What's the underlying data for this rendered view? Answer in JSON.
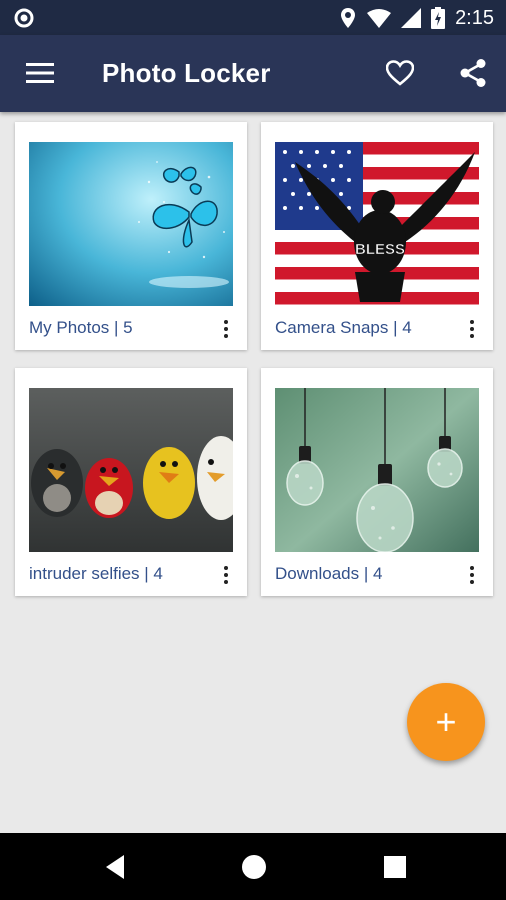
{
  "status_bar": {
    "time": "2:15"
  },
  "app_bar": {
    "title": "Photo Locker"
  },
  "albums": [
    {
      "label": "My Photos | 5"
    },
    {
      "label": "Camera Snaps | 4"
    },
    {
      "label": "intruder selfies | 4"
    },
    {
      "label": "Downloads | 4"
    }
  ],
  "fab": {
    "label": "+"
  },
  "colors": {
    "app_bar": "#2a3557",
    "status_bar": "#1f2a44",
    "accent": "#f7941d",
    "label_text": "#33508a"
  }
}
